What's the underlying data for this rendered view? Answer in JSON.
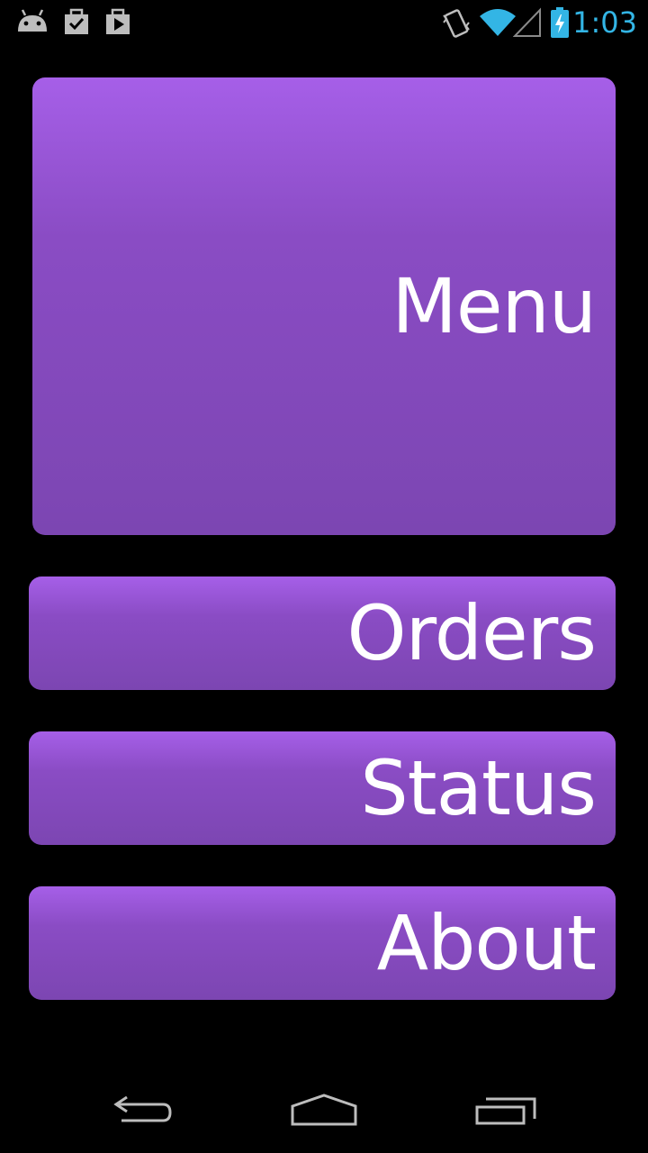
{
  "status_bar": {
    "time": "1:03",
    "icons": {
      "android": "android-icon",
      "task_check": "task-check-icon",
      "task_play": "task-play-icon",
      "vibrate": "vibrate-icon",
      "wifi": "wifi-icon",
      "signal": "signal-icon",
      "battery": "battery-charging-icon"
    },
    "accent_color": "#33b5e5"
  },
  "main": {
    "buttons": [
      {
        "label": "Menu"
      },
      {
        "label": "Orders"
      },
      {
        "label": "Status"
      },
      {
        "label": "About"
      }
    ],
    "button_color_top": "#a65fe8",
    "button_color_bottom": "#7c46b2"
  },
  "nav_bar": {
    "icons": {
      "back": "back-icon",
      "home": "home-icon",
      "recents": "recents-icon"
    }
  }
}
